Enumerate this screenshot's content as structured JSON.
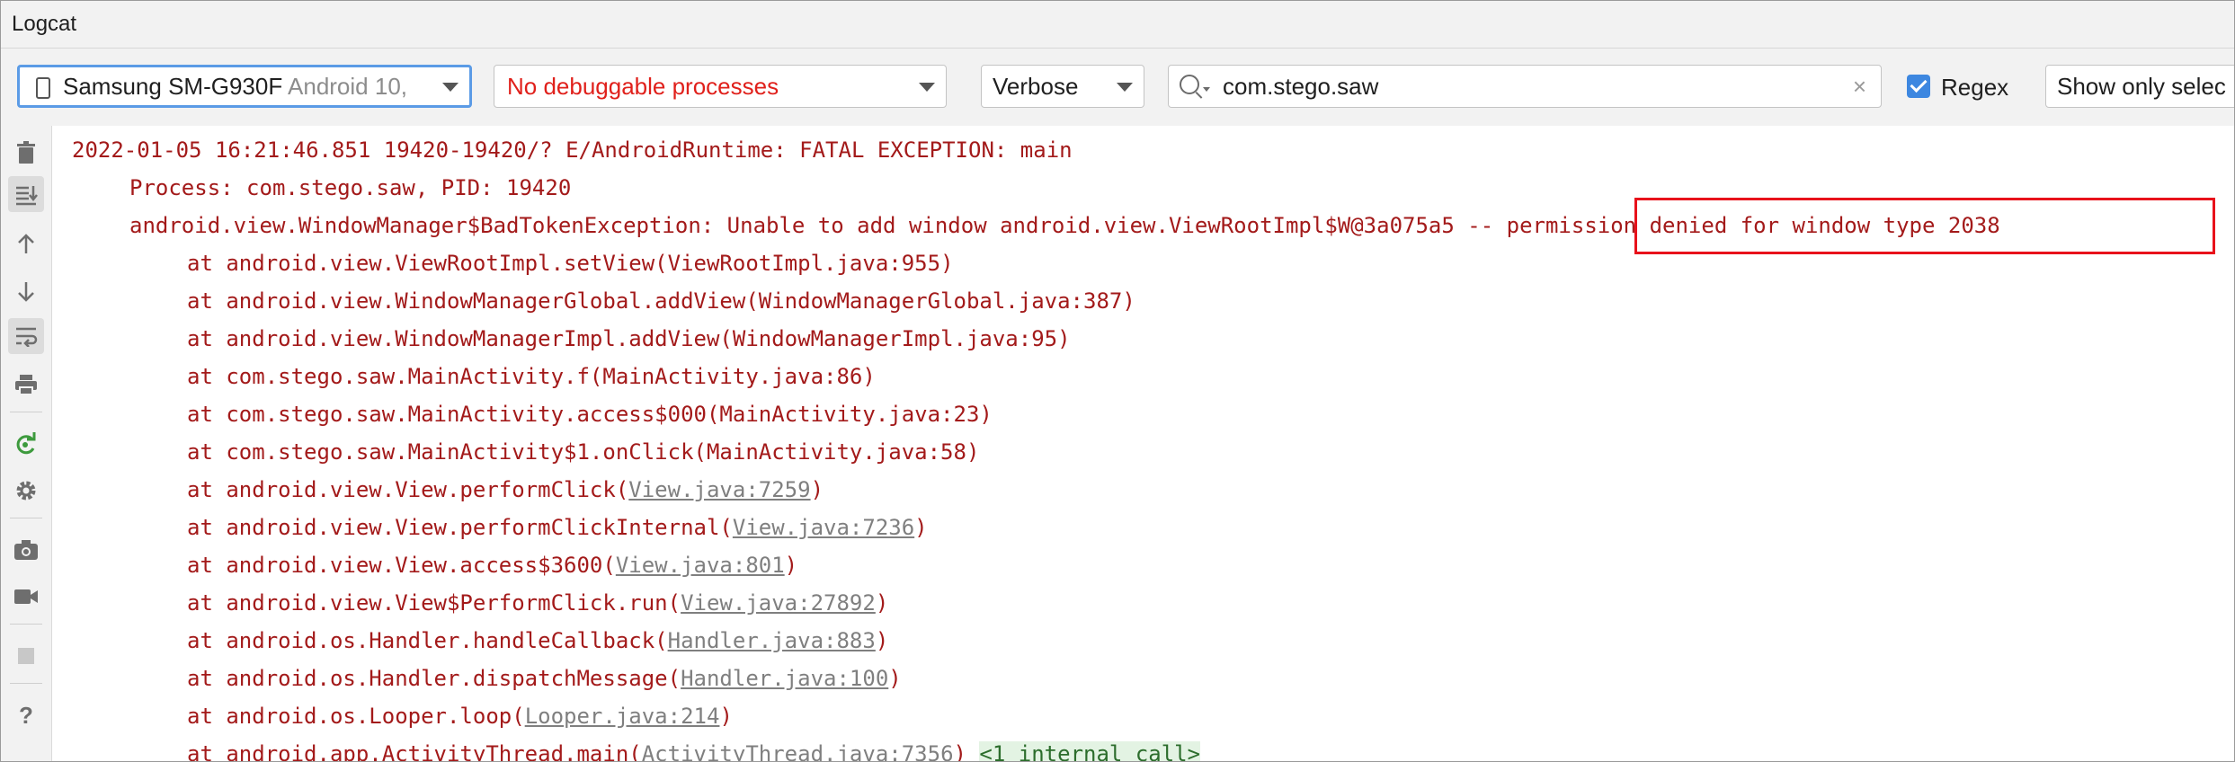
{
  "window": {
    "title": "Logcat"
  },
  "toolbar": {
    "device_name": "Samsung SM-G930F",
    "device_android": "Android 10,",
    "process": "No debuggable processes",
    "log_level": "Verbose",
    "search_value": "com.stego.saw",
    "clear_symbol": "×",
    "regex_label": "Regex",
    "regex_checked": true,
    "filter_option": "Show only selec"
  },
  "colors": {
    "error_text": "#a31a1a",
    "link": "#7f7f7f",
    "highlight": "#e8121b",
    "accent": "#3d87e0"
  },
  "sidebar_icons": [
    "trash-icon",
    "scroll-to-end-icon",
    "up-arrow-icon",
    "down-arrow-icon",
    "soft-wrap-icon",
    "print-icon",
    "restart-icon",
    "settings-icon",
    "camera-icon",
    "video-icon",
    "stop-icon",
    "help-icon"
  ],
  "log": {
    "header": "2022-01-05 16:21:46.851 19420-19420/? E/AndroidRuntime: FATAL EXCEPTION: main",
    "process_line": "Process: com.stego.saw, PID: 19420",
    "exception_prefix": "android.view.WindowManager$BadTokenException: Unable to add window android.view.ViewRootImpl$W@3a075a5 -- ",
    "exception_highlight": "permission denied for window type 2038",
    "frames": [
      {
        "method": "at android.view.ViewRootImpl.setView(",
        "source": "ViewRootImpl.java:955",
        "close": ")",
        "link": false
      },
      {
        "method": "at android.view.WindowManagerGlobal.addView(",
        "source": "WindowManagerGlobal.java:387",
        "close": ")",
        "link": false
      },
      {
        "method": "at android.view.WindowManagerImpl.addView(",
        "source": "WindowManagerImpl.java:95",
        "close": ")",
        "link": false
      },
      {
        "method": "at com.stego.saw.MainActivity.f(",
        "source": "MainActivity.java:86",
        "close": ")",
        "link": false
      },
      {
        "method": "at com.stego.saw.MainActivity.access$000(",
        "source": "MainActivity.java:23",
        "close": ")",
        "link": false
      },
      {
        "method": "at com.stego.saw.MainActivity$1.onClick(",
        "source": "MainActivity.java:58",
        "close": ")",
        "link": false
      },
      {
        "method": "at android.view.View.performClick(",
        "source": "View.java:7259",
        "close": ")",
        "link": true
      },
      {
        "method": "at android.view.View.performClickInternal(",
        "source": "View.java:7236",
        "close": ")",
        "link": true
      },
      {
        "method": "at android.view.View.access$3600(",
        "source": "View.java:801",
        "close": ")",
        "link": true
      },
      {
        "method": "at android.view.View$PerformClick.run(",
        "source": "View.java:27892",
        "close": ")",
        "link": true
      },
      {
        "method": "at android.os.Handler.handleCallback(",
        "source": "Handler.java:883",
        "close": ")",
        "link": true
      },
      {
        "method": "at android.os.Handler.dispatchMessage(",
        "source": "Handler.java:100",
        "close": ")",
        "link": true
      },
      {
        "method": "at android.os.Looper.loop(",
        "source": "Looper.java:214",
        "close": ")",
        "link": true
      },
      {
        "method": "at android.app.ActivityThread.main(",
        "source": "ActivityThread.java:7356",
        "close": ") ",
        "link": true,
        "internal": "<1 internal call>"
      }
    ]
  }
}
